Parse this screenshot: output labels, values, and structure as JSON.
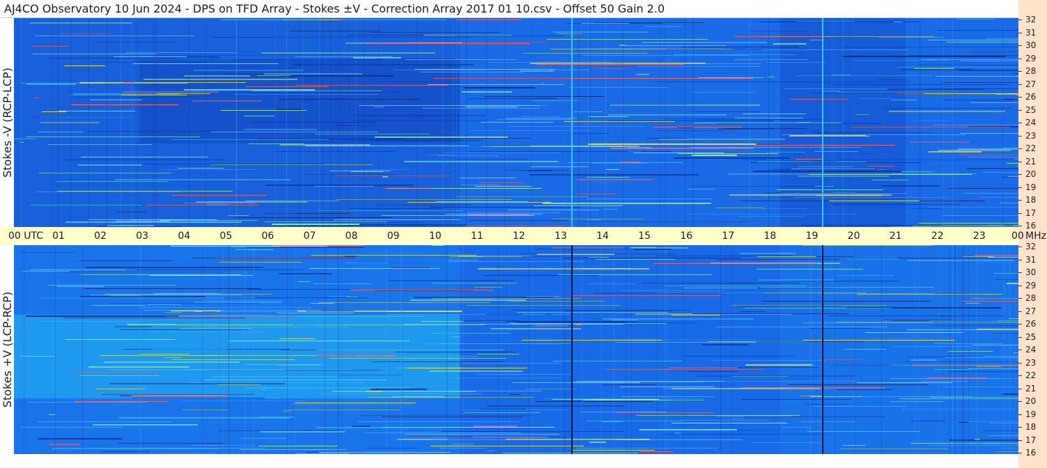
{
  "title": "AJ4CO Observatory  10 Jun 2024  -  DPS on TFD Array  -  Stokes ±V  -  Correction Array 2017 01 10.csv  -  Offset 50  Gain 2.0",
  "panels": [
    {
      "id": "top",
      "ylabel": "Stokes -V  (RCP-LCP)"
    },
    {
      "id": "bottom",
      "ylabel": "Stokes +V  (LCP-RCP)"
    }
  ],
  "time_axis": {
    "labels": [
      "00  UTC",
      "01",
      "02",
      "03",
      "04",
      "05",
      "06",
      "07",
      "08",
      "09",
      "10",
      "11",
      "12",
      "13",
      "14",
      "15",
      "16",
      "17",
      "18",
      "19",
      "20",
      "21",
      "22",
      "23",
      "00"
    ],
    "unit": "MHz"
  },
  "frequency_axis": {
    "labels": [
      "32",
      "31",
      "30",
      "29",
      "28",
      "27",
      "26",
      "25",
      "24",
      "23",
      "22",
      "21",
      "20",
      "19",
      "18",
      "17",
      "16"
    ]
  },
  "colors": {
    "plot_background": "#1565e8",
    "time_axis_background": "#ffffcc",
    "freq_axis_background": "#ffe2cc"
  }
}
